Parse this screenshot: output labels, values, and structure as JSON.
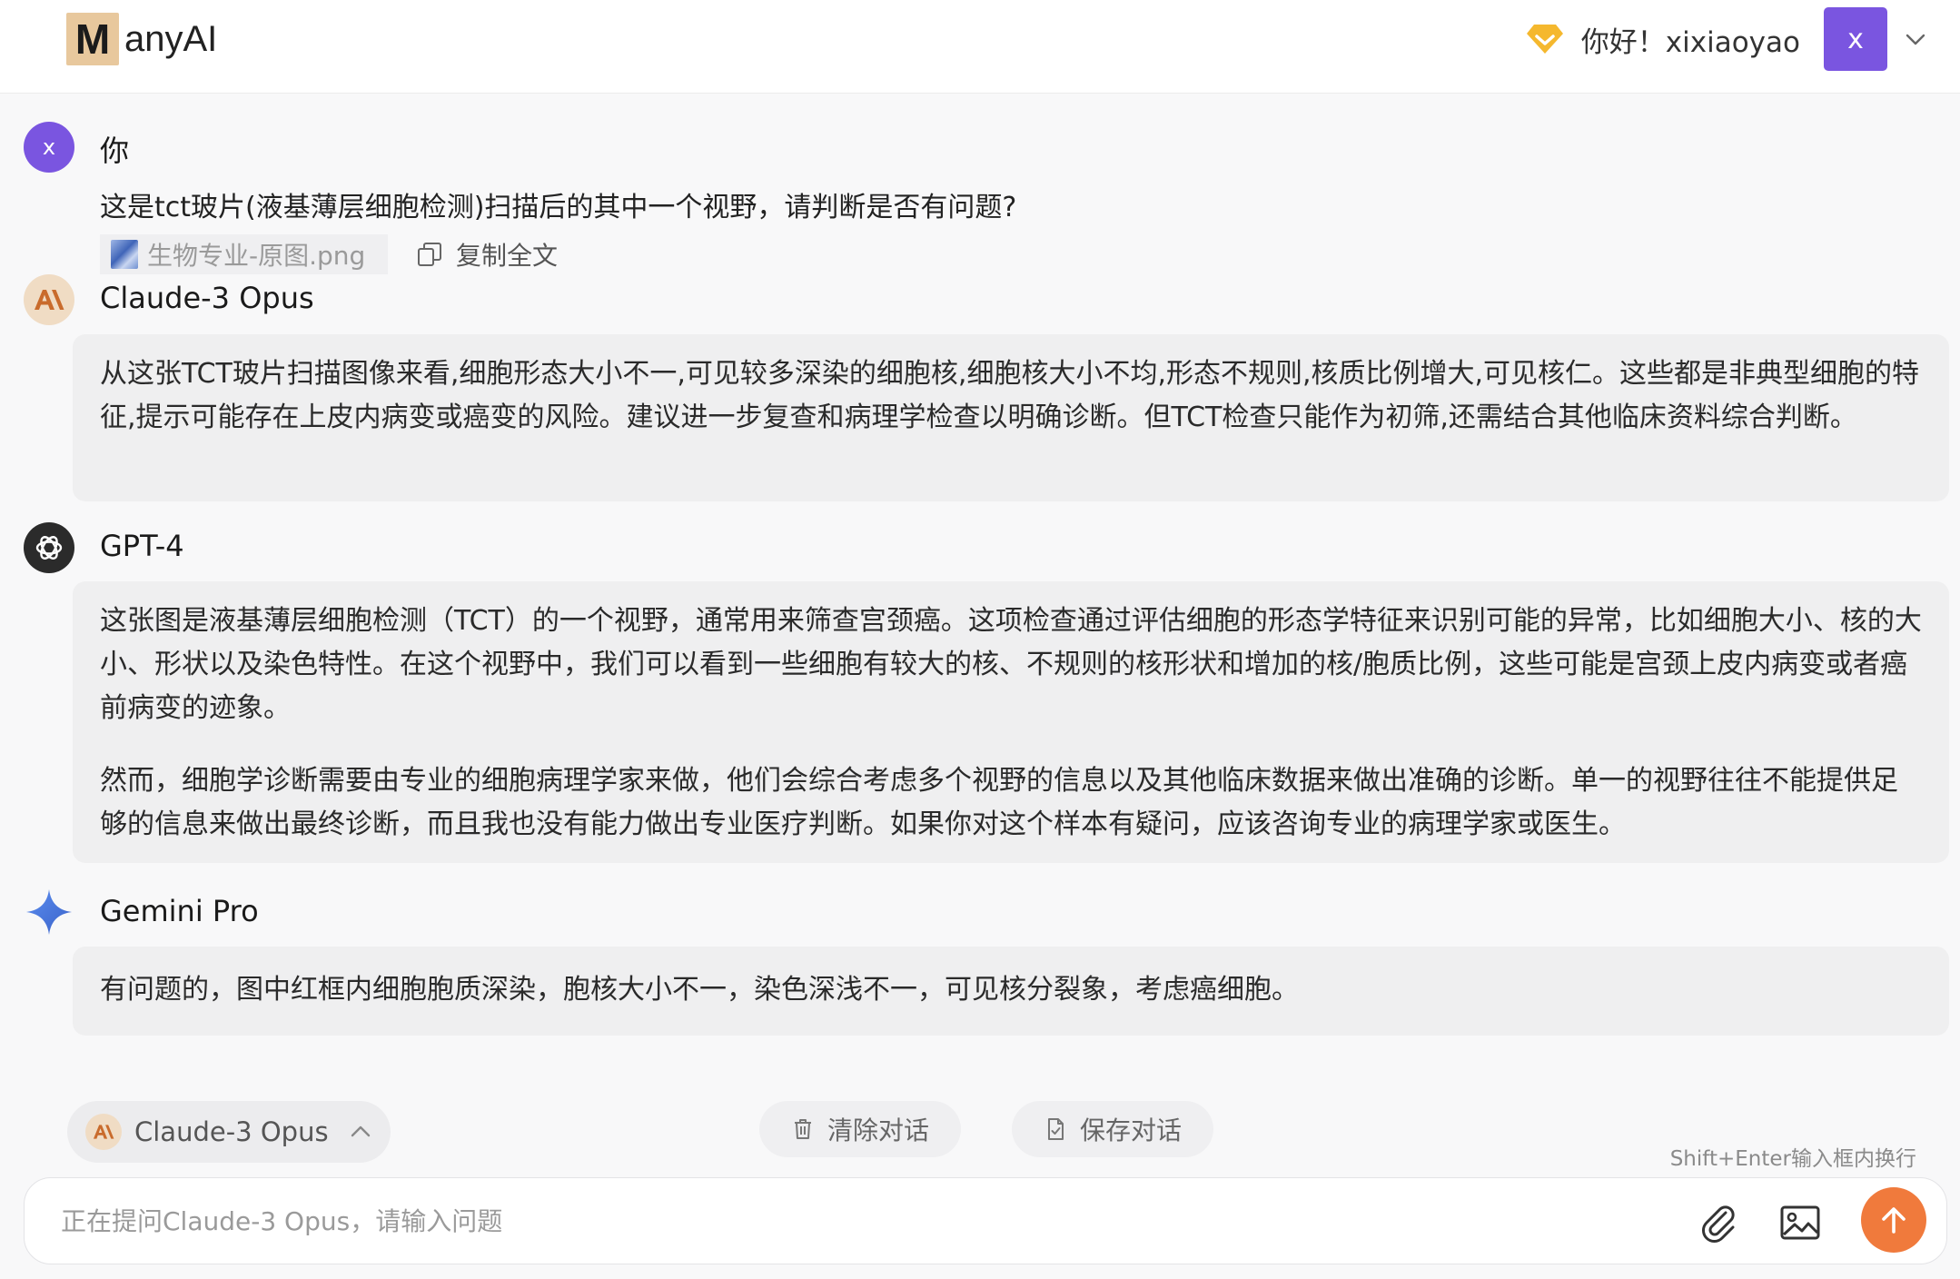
{
  "header": {
    "logo_letter": "M",
    "logo_text": "anyAI",
    "greeting": "你好！xixiaoyao",
    "avatar_letter": "x"
  },
  "conversation": {
    "user": {
      "avatar_letter": "x",
      "name": "你",
      "question": "这是tct玻片(液基薄层细胞检测)扫描后的其中一个视野，请判断是否有问题?",
      "attachment": "生物专业-原图.png",
      "copy_label": "复制全文"
    },
    "claude": {
      "name": "Claude-3 Opus",
      "paragraphs": [
        "从这张TCT玻片扫描图像来看,细胞形态大小不一,可见较多深染的细胞核,细胞核大小不均,形态不规则,核质比例增大,可见核仁。这些都是非典型细胞的特征,提示可能存在上皮内病变或癌变的风险。建议进一步复查和病理学检查以明确诊断。但TCT检查只能作为初筛,还需结合其他临床资料综合判断。"
      ]
    },
    "gpt": {
      "name": "GPT-4",
      "paragraphs": [
        "这张图是液基薄层细胞检测（TCT）的一个视野，通常用来筛查宫颈癌。这项检查通过评估细胞的形态学特征来识别可能的异常，比如细胞大小、核的大小、形状以及染色特性。在这个视野中，我们可以看到一些细胞有较大的核、不规则的核形状和增加的核/胞质比例，这些可能是宫颈上皮内病变或者癌前病变的迹象。",
        "然而，细胞学诊断需要由专业的细胞病理学家来做，他们会综合考虑多个视野的信息以及其他临床数据来做出准确的诊断。单一的视野往往不能提供足够的信息来做出最终诊断，而且我也没有能力做出专业医疗判断。如果你对这个样本有疑问，应该咨询专业的病理学家或医生。"
      ]
    },
    "gemini": {
      "name": "Gemini Pro",
      "paragraphs": [
        "有问题的，图中红框内细胞胞质深染，胞核大小不一，染色深浅不一，可见核分裂象，考虑癌细胞。"
      ]
    }
  },
  "controls": {
    "model_selected": "Claude-3 Opus",
    "clear_label": "清除对话",
    "save_label": "保存对话",
    "hint": "Shift+Enter输入框内换行",
    "input_placeholder": "正在提问Claude-3 Opus，请输入问题"
  },
  "colors": {
    "accent_purple": "#7a55e0",
    "send_orange": "#f07a3c",
    "claude_bg": "#f0dcc4",
    "diamond_yellow": "#f5b82e"
  }
}
